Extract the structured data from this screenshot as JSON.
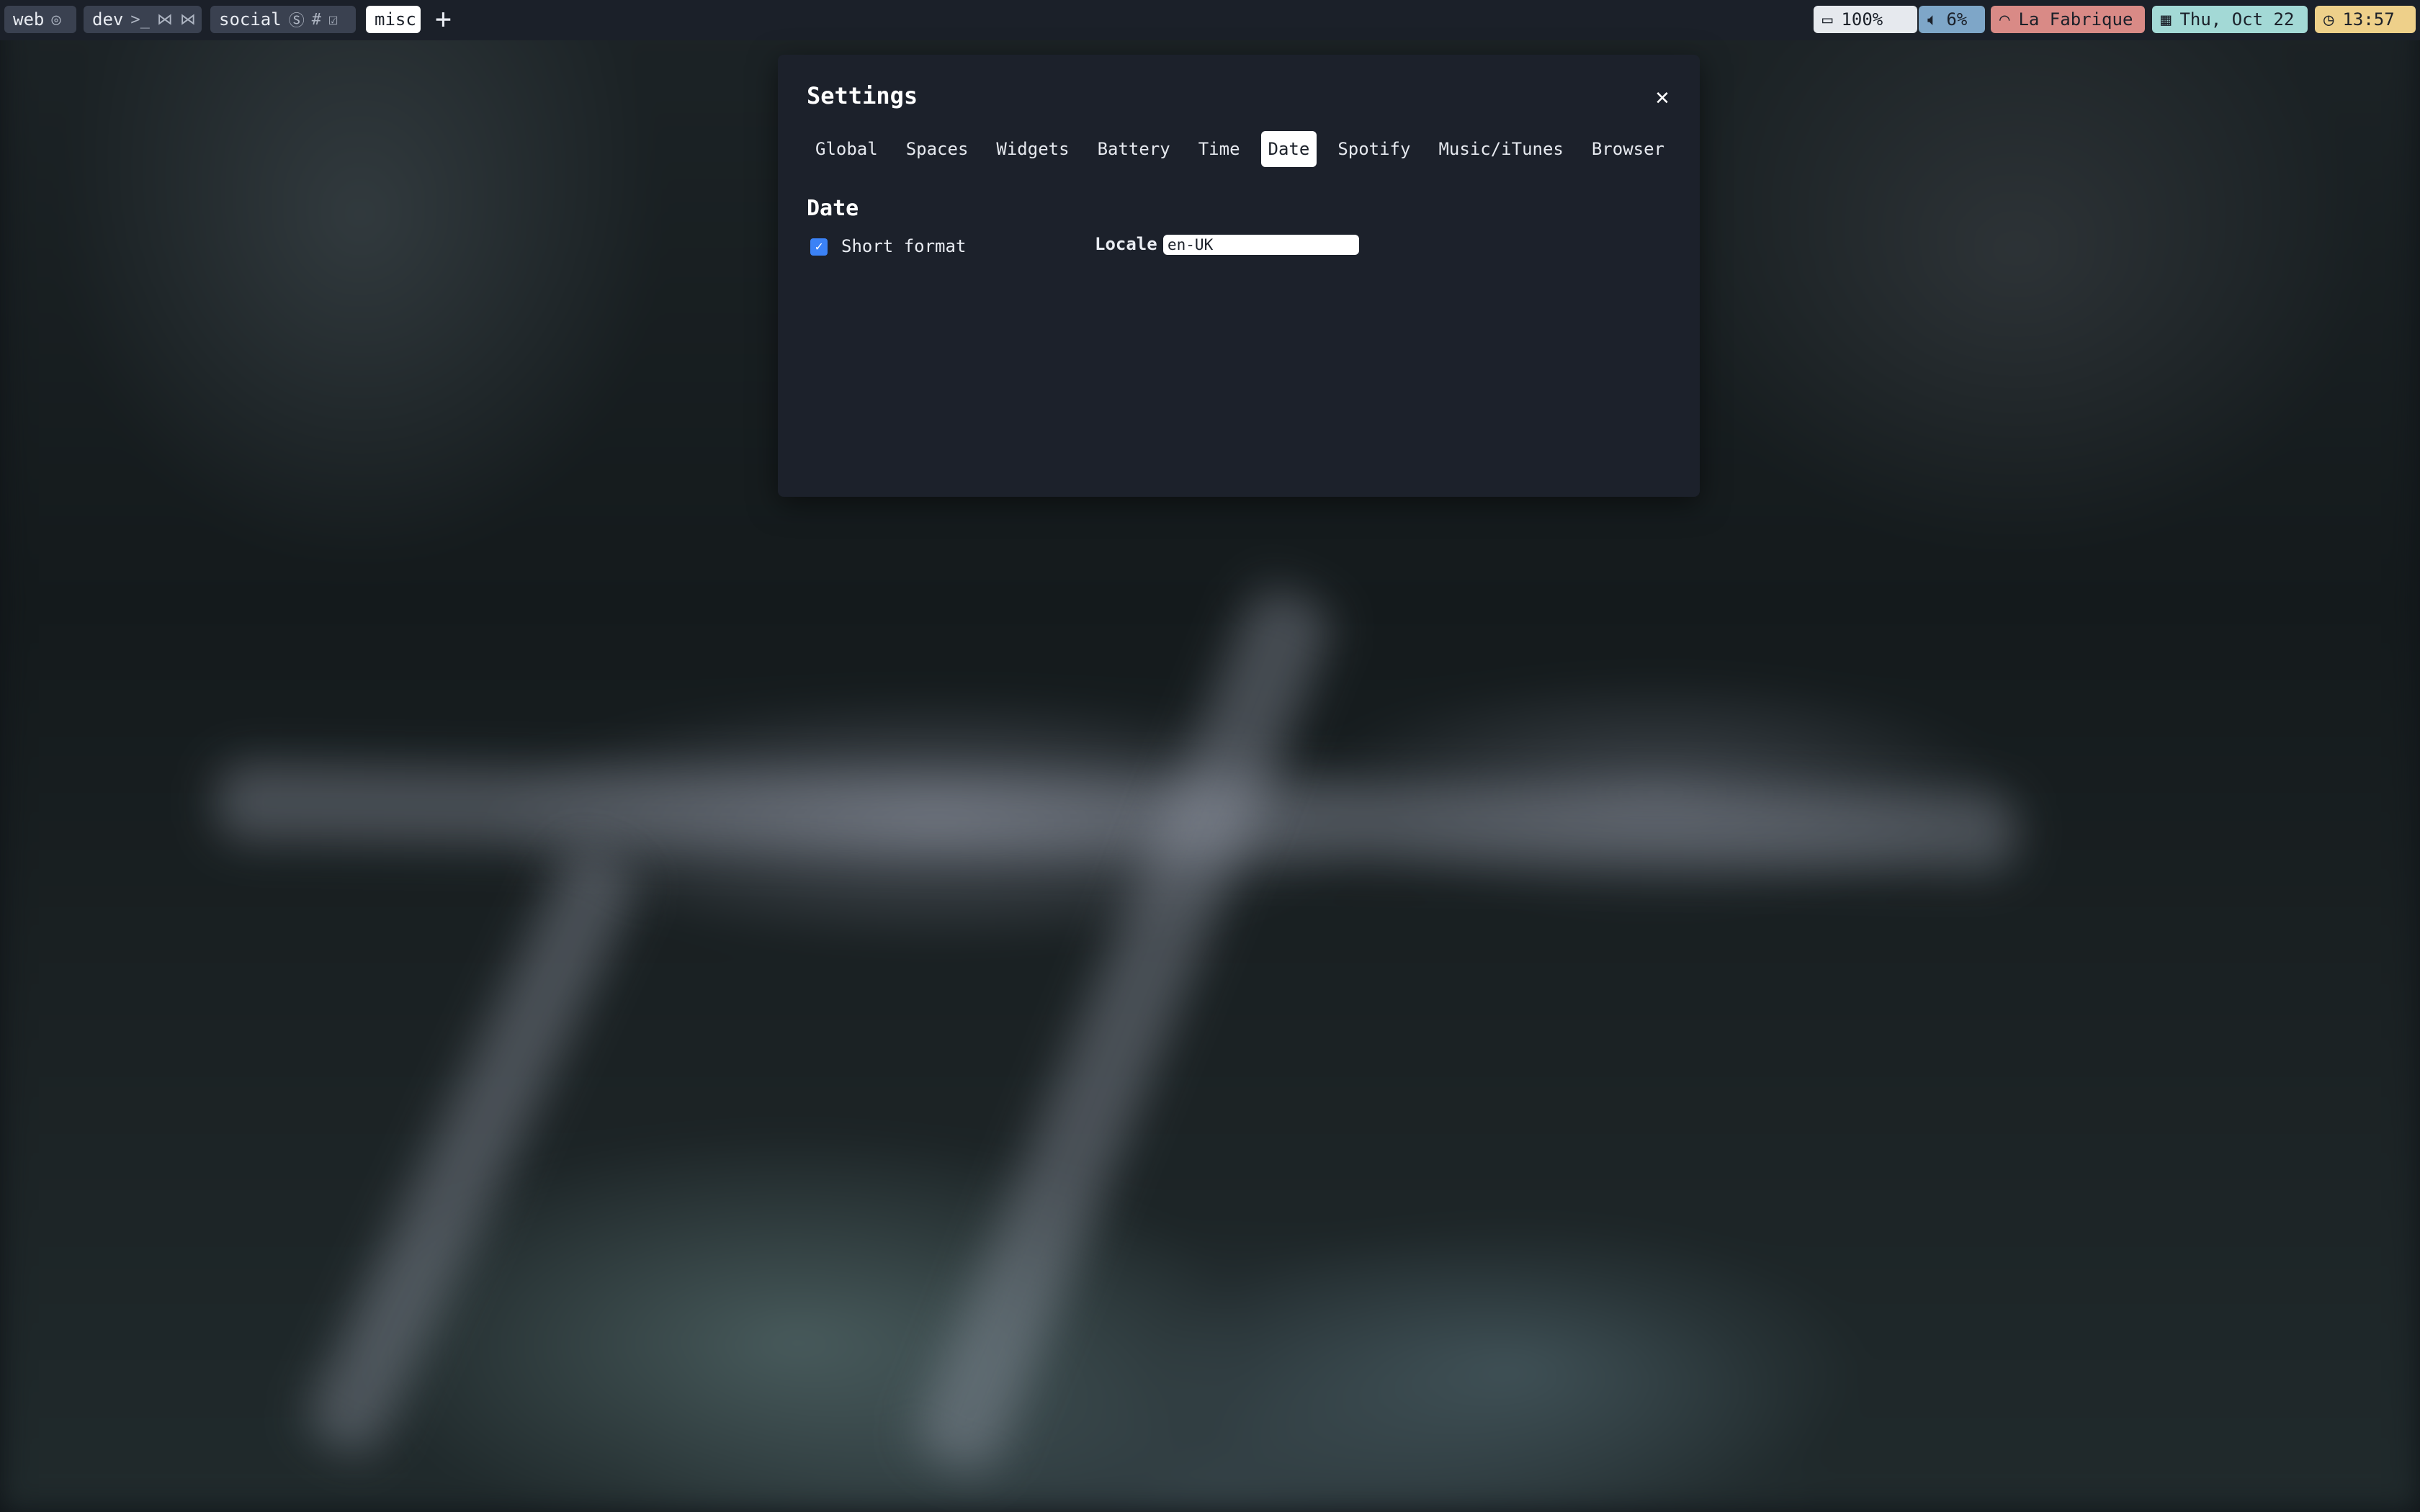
{
  "spaces": [
    {
      "label": "web",
      "icons": [
        "chrome-icon"
      ]
    },
    {
      "label": "dev",
      "icons": [
        "terminal-icon",
        "vscode-icon",
        "vscode-icon"
      ]
    },
    {
      "label": "social",
      "icons": [
        "skype-icon",
        "slack-icon",
        "todo-icon"
      ]
    },
    {
      "label": "misc",
      "icons": [],
      "active": true
    }
  ],
  "add_space_label": "+",
  "widgets": {
    "battery": {
      "value": "100%",
      "icon": "battery-icon",
      "color": "#e6e9ee"
    },
    "sound": {
      "value": "6%",
      "icon": "speaker-icon",
      "color": "#7ea6c8"
    },
    "wifi": {
      "value": "La Fabrique",
      "icon": "wifi-icon",
      "color": "#d98a86"
    },
    "date": {
      "value": "Thu, Oct 22",
      "icon": "calendar-icon",
      "color": "#a3d9d6"
    },
    "time": {
      "value": "13:57",
      "icon": "clock-icon",
      "color": "#eed08a"
    }
  },
  "settings": {
    "title": "Settings",
    "close_label": "✕",
    "tabs": [
      "Global",
      "Spaces",
      "Widgets",
      "Battery",
      "Time",
      "Date",
      "Spotify",
      "Music/iTunes",
      "Browser"
    ],
    "active_tab": "Date",
    "section_title": "Date",
    "short_format": {
      "label": "Short format",
      "checked": true
    },
    "locale": {
      "label": "Locale",
      "value": "en-UK"
    }
  }
}
